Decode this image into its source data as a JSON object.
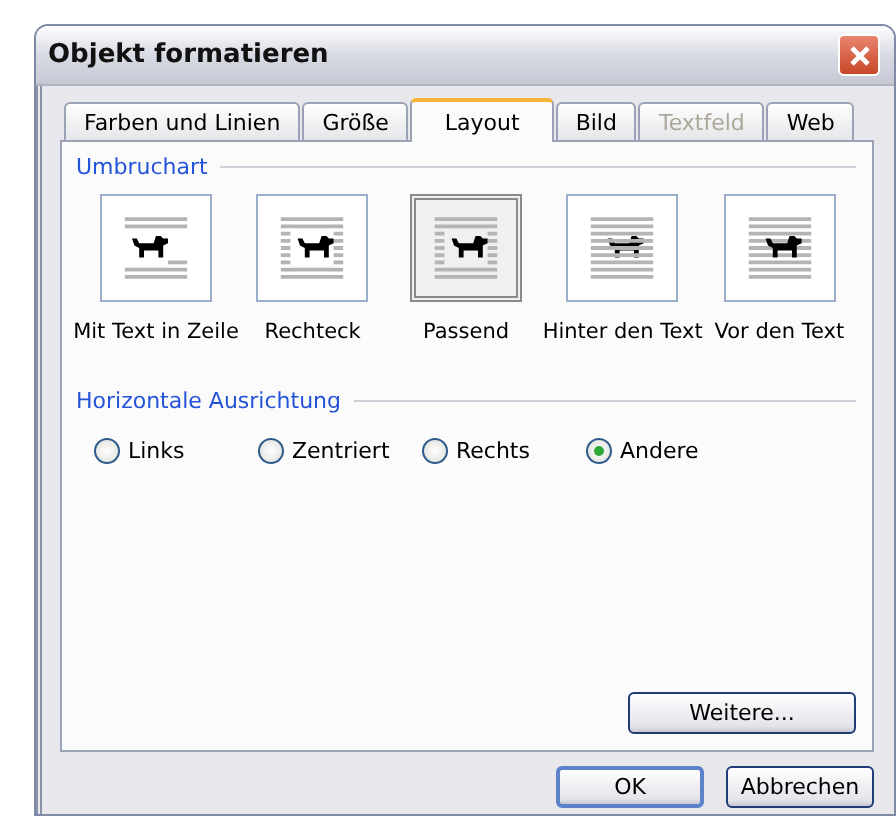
{
  "window": {
    "title": "Objekt formatieren"
  },
  "tabs": [
    {
      "label": "Farben und Linien",
      "selected": false,
      "disabled": false
    },
    {
      "label": "Größe",
      "selected": false,
      "disabled": false
    },
    {
      "label": "Layout",
      "selected": true,
      "disabled": false
    },
    {
      "label": "Bild",
      "selected": false,
      "disabled": false
    },
    {
      "label": "Textfeld",
      "selected": false,
      "disabled": true
    },
    {
      "label": "Web",
      "selected": false,
      "disabled": false
    }
  ],
  "wrap_section": {
    "title": "Umbruchart",
    "options": [
      {
        "label": "Mit Text in Zeile",
        "kind": "inline",
        "selected": false
      },
      {
        "label": "Rechteck",
        "kind": "square",
        "selected": false
      },
      {
        "label": "Passend",
        "kind": "tight",
        "selected": true
      },
      {
        "label": "Hinter den Text",
        "kind": "behind",
        "selected": false
      },
      {
        "label": "Vor den Text",
        "kind": "front",
        "selected": false
      }
    ]
  },
  "alignment_section": {
    "title": "Horizontale Ausrichtung",
    "options": [
      {
        "label": "Links",
        "selected": false
      },
      {
        "label": "Zentriert",
        "selected": false
      },
      {
        "label": "Rechts",
        "selected": false
      },
      {
        "label": "Andere",
        "selected": true
      }
    ]
  },
  "more_button": "Weitere...",
  "buttons": [
    "OK",
    "Abbrechen"
  ]
}
